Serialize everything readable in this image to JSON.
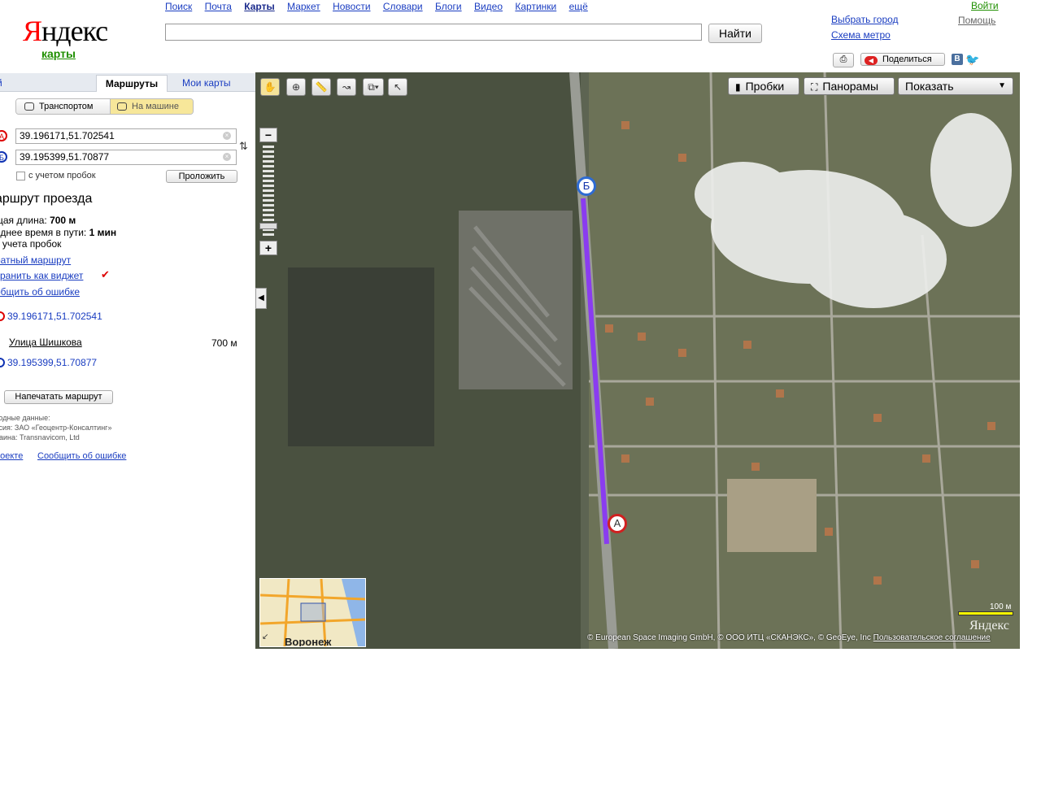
{
  "header": {
    "logo_text": "Яндекс",
    "logo_sub": "карты",
    "nav": [
      "Поиск",
      "Почта",
      "Карты",
      "Маркет",
      "Новости",
      "Словари",
      "Блоги",
      "Видео",
      "Картинки",
      "ещё"
    ],
    "nav_current": "Карты",
    "search_value": "",
    "search_button": "Найти",
    "choose_city": "Выбрать город",
    "metro_map": "Схема метро",
    "login": "Войти",
    "help": "Помощь",
    "share": "Поделиться"
  },
  "left_panel": {
    "tab_prev": "й",
    "tab_routes": "Маршруты",
    "tab_mymaps": "Мои карты",
    "mode_transport": "Транспортом",
    "mode_car": "На машине",
    "point_a_label": "A",
    "point_b_label": "Б",
    "point_a_value": "39.196171,51.702541",
    "point_b_value": "39.195399,51.70877",
    "traffic_checkbox": "с учетом пробок",
    "build_button": "Проложить",
    "route_title": "аршрут проезда",
    "total_length_label": "щая длина:",
    "total_length_value": "700 м",
    "avg_time_label": "еднее время в пути:",
    "avg_time_value": "1 мин",
    "without_traffic": "з учета пробок",
    "reverse_link": "ратный маршрут",
    "save_widget_link": "хранить как виджет",
    "report_error_link": "общить об ошибке",
    "step_a": "39.196171,51.702541",
    "step_street": "Улица Шишкова",
    "step_distance": "700 м",
    "step_b": "39.195399,51.70877",
    "print_route": "Напечатать маршрут",
    "source_label": "ходные данные:",
    "source_line1": "ссия: ЗАО «Геоцентр-Консалтинг»",
    "source_line2": "раина: Transnavicom, Ltd",
    "about_link": "роекте",
    "report_link2": "Сообщить об ошибке"
  },
  "map": {
    "btn_traffic": "Пробки",
    "btn_panorama": "Панорамы",
    "btn_show": "Показать",
    "pin_a": "A",
    "pin_b": "Б",
    "minimap_city": "Воронеж",
    "copyright": "© European Space Imaging GmbH, © ООО ИТЦ «СКАНЭКС», © GeoEye, Inc",
    "agreement": "Пользовательское соглашение",
    "scale": "100 м",
    "logo": "Яндекс",
    "route_color": "#8a3cf0"
  }
}
